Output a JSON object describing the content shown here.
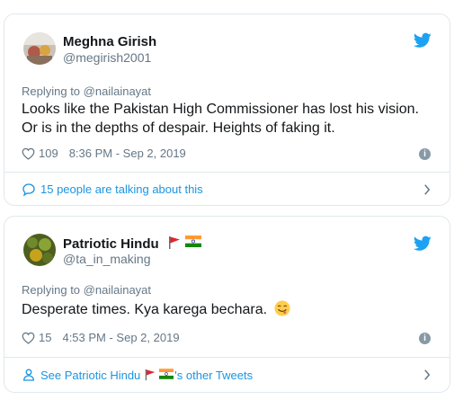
{
  "tweets": [
    {
      "author_name": "Meghna Girish",
      "author_handle": "@megirish2001",
      "replying_prefix": "Replying to",
      "replying_to": "@nailainayat",
      "text_lines": [
        "Looks like the Pakistan High Commissioner has lost his vision.",
        "Or is in the depths of despair. Heights of faking it."
      ],
      "likes": "109",
      "timestamp": "8:36 PM - Sep 2, 2019",
      "footer_text": "15 people are talking about this",
      "footer_icon": "speech-bubble-icon"
    },
    {
      "author_name": "Patriotic Hindu",
      "author_handle": "@ta_in_making",
      "replying_prefix": "Replying to",
      "replying_to": "@nailainayat",
      "text": "Desperate times. Kya karega bechara.",
      "likes": "15",
      "timestamp": "4:53 PM - Sep 2, 2019",
      "footer_prefix": "See Patriotic Hindu",
      "footer_suffix": "'s other Tweets",
      "footer_icon": "person-icon"
    }
  ],
  "colors": {
    "link": "#1b95e0",
    "muted": "#657786",
    "text": "#14171a",
    "border": "#e1e8ed",
    "twitter_blue": "#1da1f2",
    "heart": "#657786"
  },
  "icons": {
    "brand": "twitter-bird-icon",
    "like": "heart-icon",
    "info": "info-icon",
    "chevron": "chevron-right-icon",
    "flag_red": "red-pennant-flag-icon",
    "flag_india": "india-flag-icon",
    "emoji": "savoring-food-face-emoji"
  }
}
